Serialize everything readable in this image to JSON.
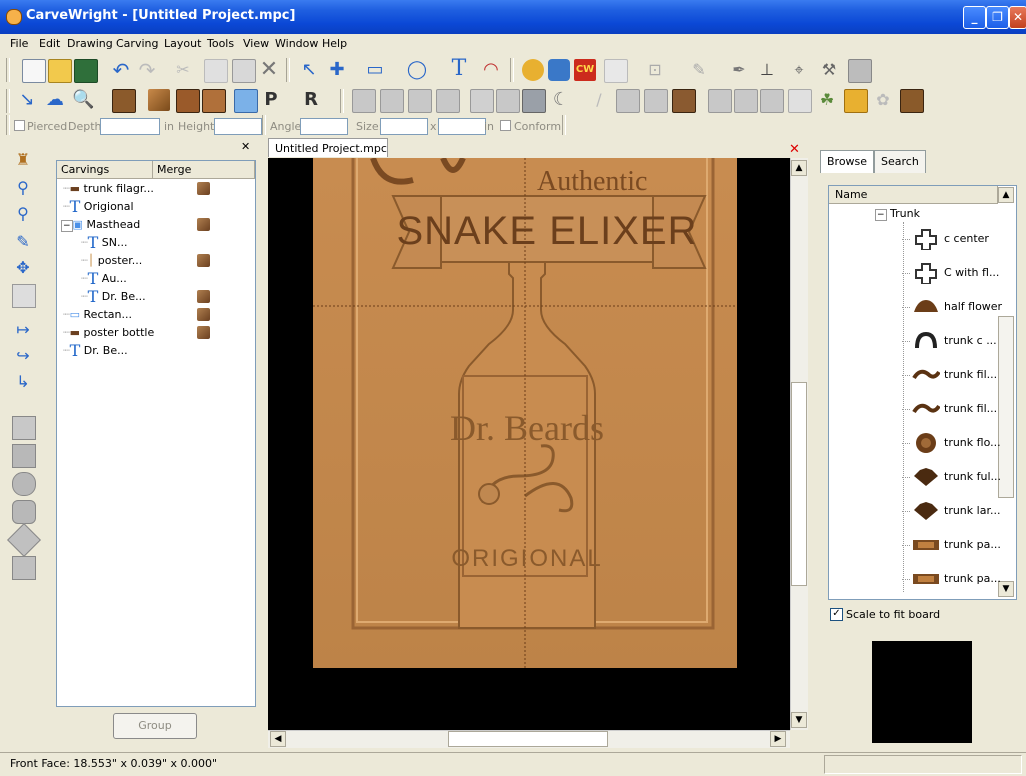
{
  "window": {
    "title": "CarveWright - [Untitled Project.mpc]"
  },
  "menu": [
    "File",
    "Edit",
    "Drawing",
    "Carving",
    "Layout",
    "Tools",
    "View",
    "Window",
    "Help"
  ],
  "props_bar": {
    "pierced": "Pierced",
    "depth": "Depth:",
    "depth_unit": "in",
    "height": "Height:",
    "angle": "Angle:",
    "size": "Size:",
    "size_x": "x",
    "size_unit": "in",
    "conform": "Conform"
  },
  "carvings": {
    "col_carvings": "Carvings",
    "col_merge": "Merge",
    "items": [
      {
        "label": "trunk filagr...",
        "icon": "pattern-icon",
        "merge": true
      },
      {
        "label": "Origional",
        "icon": "text-icon",
        "merge": false
      },
      {
        "label": "Masthead",
        "icon": "group-icon",
        "merge": true
      },
      {
        "label": "SN...",
        "icon": "text-icon",
        "merge": false
      },
      {
        "label": "poster...",
        "icon": "line-icon",
        "merge": true
      },
      {
        "label": "Au...",
        "icon": "text-icon",
        "merge": false
      },
      {
        "label": "Dr. Be...",
        "icon": "text-icon",
        "merge": true
      },
      {
        "label": "Rectan...",
        "icon": "rectangle-icon",
        "merge": true
      },
      {
        "label": "poster bottle",
        "icon": "bottle-icon",
        "merge": true
      },
      {
        "label": "Dr. Be...",
        "icon": "text-icon",
        "merge": false
      }
    ],
    "group_button": "Group"
  },
  "document": {
    "tab": "Untitled Project.mpc",
    "board_text": {
      "authentic": "Authentic",
      "snake": "SNAKE ELIXER",
      "dr": "Dr. Beards",
      "orig": "ORIGIONAL"
    }
  },
  "browser": {
    "tab_browse": "Browse",
    "tab_search": "Search",
    "col_name": "Name",
    "folder": "Trunk",
    "items": [
      {
        "label": "c center",
        "icon": "cross-outline-icon"
      },
      {
        "label": "C with fl...",
        "icon": "cross-outline-icon"
      },
      {
        "label": "half flower",
        "icon": "half-flower-icon"
      },
      {
        "label": "trunk c ...",
        "icon": "arc-icon"
      },
      {
        "label": "trunk fil...",
        "icon": "filigree-icon"
      },
      {
        "label": "trunk fil...",
        "icon": "filigree-icon"
      },
      {
        "label": "trunk flo...",
        "icon": "round-flower-icon"
      },
      {
        "label": "trunk ful...",
        "icon": "fan-icon"
      },
      {
        "label": "trunk lar...",
        "icon": "fan-icon"
      },
      {
        "label": "trunk pa...",
        "icon": "panel-icon"
      },
      {
        "label": "trunk pa...",
        "icon": "panel-icon"
      }
    ],
    "scale_label": "Scale to fit board",
    "scale_checked": true
  },
  "status": {
    "text": "Front Face: 18.553\" x 0.039\" x 0.000\""
  }
}
